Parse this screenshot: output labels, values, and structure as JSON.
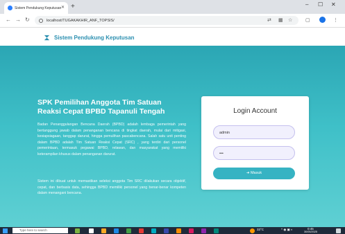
{
  "browser": {
    "tab_title": "Sistem Pendukung Keputusan",
    "url": "localhost/TUGAKAKHIR_ANF_TOPSIS/",
    "new_tab": "+",
    "win_min": "–",
    "win_max": "☐",
    "win_close": "✕"
  },
  "header": {
    "brand": "Sistem Pendukung Keputusan"
  },
  "hero": {
    "title": "SPK Pemilihan Anggota Tim Satuan Reaksi Cepat BPBD Tapanuli Tengah",
    "para1": "Badan Penanggulangan Bencana Daerah (BPBD) adalah lembaga pemerintah yang bertanggung jawab dalam penanganan bencana di tingkat daerah, mulai dari mitigasi, kesiapsiagaan, tanggap darurat, hingga pemulihan pascabencana. Salah satu unit penting dalam BPBD adalah Tim Satuan Reaksi Cepat (SRC) , yang terdiri dari personel pemerintaan, termasuk pegawai BPBD, relawan, dan masyarakat yang memiliki keterampilan khusus dalam penanganan darurat.",
    "para2": "Sistem ini dibuat untuk memastikan seleksi anggota Tim SRC dilakukan secara objektif, cepat, dan berbasis data, sehingga BPBD memiliki personel yang benar-benar kompeten dalam menangani bencana."
  },
  "login": {
    "title": "Login Account",
    "username_value": "admin",
    "password_value": "•••",
    "button_label": "Masuk"
  },
  "taskbar": {
    "search_placeholder": "Type here to search",
    "weather": "33°C",
    "time": "0:45",
    "date": "30/05/2025"
  }
}
